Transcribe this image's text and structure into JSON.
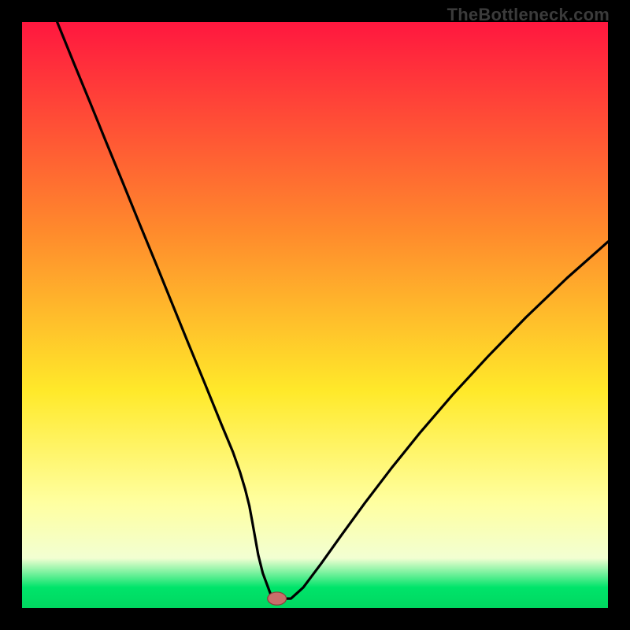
{
  "watermark": "TheBottleneck.com",
  "colors": {
    "frame": "#000000",
    "curve": "#000000",
    "marker_fill": "#c86f6b",
    "marker_stroke": "#8c3d3a",
    "grad_top": "#ff173f",
    "grad_orange": "#ff8b2c",
    "grad_yellow": "#ffe92a",
    "grad_lightyellow": "#ffffa0",
    "grad_pale": "#f2ffd2",
    "grad_green": "#00e46a",
    "grad_bottom": "#00d760"
  },
  "chart_data": {
    "type": "line",
    "title": "",
    "xlabel": "",
    "ylabel": "",
    "xlim": [
      0,
      100
    ],
    "ylim": [
      0,
      100
    ],
    "x": [
      6.0,
      8.8,
      11.6,
      14.4,
      17.2,
      20.0,
      22.8,
      25.6,
      28.4,
      31.2,
      34.0,
      36.0,
      37.2,
      38.1,
      38.8,
      39.3,
      39.8,
      40.3,
      41.1,
      42.7,
      44.3,
      45.9,
      48.0,
      51.0,
      54.5,
      58.5,
      63.0,
      68.0,
      73.5,
      79.5,
      86.0,
      93.0,
      100.0
    ],
    "values": [
      100.0,
      93.1,
      86.3,
      79.4,
      72.6,
      65.7,
      58.9,
      52.0,
      45.1,
      38.3,
      31.4,
      26.6,
      23.2,
      20.2,
      17.4,
      14.7,
      11.9,
      9.1,
      5.9,
      1.6,
      1.6,
      1.6,
      3.5,
      7.5,
      12.4,
      17.9,
      23.8,
      30.0,
      36.4,
      42.9,
      49.6,
      56.3,
      62.5
    ],
    "marker": {
      "x": 43.5,
      "y": 1.6,
      "rx": 1.6,
      "ry": 1.1
    },
    "flat_band": {
      "x0": 40.6,
      "x1": 46.0,
      "y": 1.6
    }
  }
}
